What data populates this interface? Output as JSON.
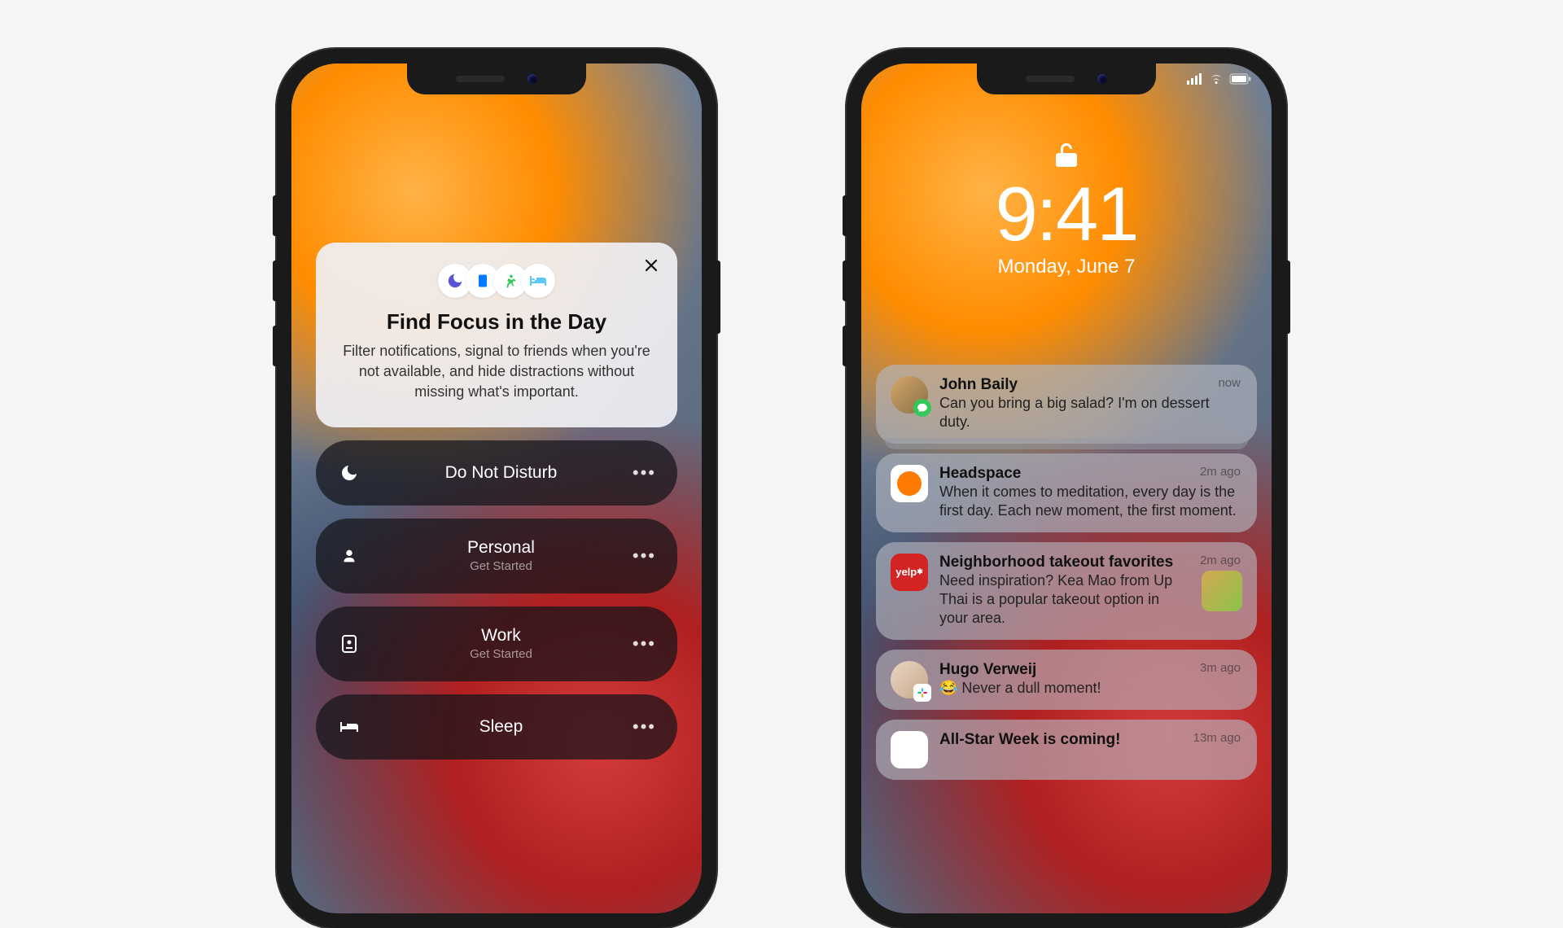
{
  "left": {
    "focus_card": {
      "title": "Find Focus in the Day",
      "body": "Filter notifications, signal to friends when you're not available, and hide distractions without missing what's important."
    },
    "items": [
      {
        "label": "Do Not Disturb",
        "sub": "",
        "icon": "moon"
      },
      {
        "label": "Personal",
        "sub": "Get Started",
        "icon": "person"
      },
      {
        "label": "Work",
        "sub": "Get Started",
        "icon": "badge"
      },
      {
        "label": "Sleep",
        "sub": "",
        "icon": "bed"
      }
    ]
  },
  "right": {
    "time": "9:41",
    "date": "Monday, June 7",
    "notifications": [
      {
        "sender": "John Baily",
        "message": "Can you bring a big salad? I'm on dessert duty.",
        "when": "now",
        "app": "messages",
        "avatar": true,
        "stacked": true
      },
      {
        "sender": "Headspace",
        "message": "When it comes to meditation, every day is the first day. Each new moment, the first moment.",
        "when": "2m ago",
        "app": "headspace"
      },
      {
        "sender": "Neighborhood takeout favorites",
        "message": "Need inspiration? Kea Mao from Up Thai is a popular takeout option in your area.",
        "when": "2m ago",
        "app": "yelp",
        "thumb": true
      },
      {
        "sender": "Hugo Verweij",
        "message": "😂 Never a dull moment!",
        "when": "3m ago",
        "app": "slack",
        "avatar": true
      },
      {
        "sender": "All-Star Week is coming!",
        "message": "",
        "when": "13m ago",
        "app": "mlb"
      }
    ]
  }
}
